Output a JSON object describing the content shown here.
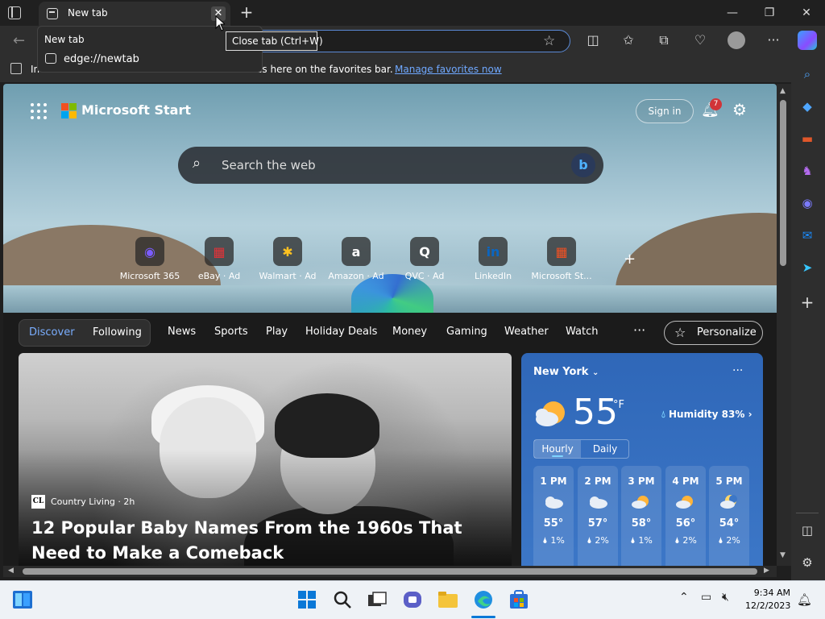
{
  "window": {
    "tab_title": "New tab",
    "minimize": "—",
    "restore": "❐",
    "close": "✕",
    "new_tab": "+",
    "tab_close": "✕"
  },
  "hover_card": {
    "title": "New tab",
    "url": "edge://newtab"
  },
  "tooltip": "Close tab (Ctrl+W)",
  "favorites_bar": {
    "import_fragment": "In",
    "hint_fragment": "ites here on the favorites bar.",
    "manage_link": "Manage favorites now"
  },
  "start": {
    "brand": "Microsoft Start",
    "sign_in": "Sign in",
    "notification_count": "7",
    "search_placeholder": "Search the web",
    "quick_links": [
      {
        "label": "Microsoft 365",
        "glyph": "◉",
        "color": "#7b5cff"
      },
      {
        "label": "eBay · Ad",
        "glyph": "▦",
        "color": "#e53238"
      },
      {
        "label": "Walmart · Ad",
        "glyph": "✱",
        "color": "#ffc220"
      },
      {
        "label": "Amazon · Ad",
        "glyph": "a",
        "color": "#ffffff"
      },
      {
        "label": "QVC · Ad",
        "glyph": "Q",
        "color": "#ffffff"
      },
      {
        "label": "LinkedIn",
        "glyph": "in",
        "color": "#0a66c2"
      },
      {
        "label": "Microsoft St...",
        "glyph": "▦",
        "color": "#f25022"
      }
    ],
    "add_shortcut": "+"
  },
  "news_nav": {
    "discover": "Discover",
    "following": "Following",
    "items": [
      "News",
      "Sports",
      "Play",
      "Holiday Deals",
      "Money",
      "Gaming",
      "Weather",
      "Watch"
    ],
    "more": "···",
    "personalize": "Personalize"
  },
  "main_story": {
    "source_logo": "CL",
    "source": "Country Living · 2h",
    "headline": "12 Popular Baby Names From the 1960s That Need to Make a Comeback"
  },
  "weather": {
    "city": "New York",
    "more": "···",
    "temp": "55",
    "unit": "°F",
    "humidity": "Humidity 83%",
    "tab_hourly": "Hourly",
    "tab_daily": "Daily",
    "hours": [
      {
        "time": "1 PM",
        "temp": "55°",
        "precip": "1%",
        "icon": "cloud-icon"
      },
      {
        "time": "2 PM",
        "temp": "57°",
        "precip": "2%",
        "icon": "cloud-icon"
      },
      {
        "time": "3 PM",
        "temp": "58°",
        "precip": "1%",
        "icon": "sun-cloud-icon"
      },
      {
        "time": "4 PM",
        "temp": "56°",
        "precip": "2%",
        "icon": "sun-cloud-icon"
      },
      {
        "time": "5 PM",
        "temp": "54°",
        "precip": "2%",
        "icon": "moon-cloud-icon"
      }
    ]
  },
  "taskbar": {
    "time": "9:34 AM",
    "date": "12/2/2023"
  },
  "colors": {
    "accent": "#5b8ad6",
    "link": "#6fa8ff",
    "weather": "#2f67b8",
    "badge": "#d13438"
  }
}
